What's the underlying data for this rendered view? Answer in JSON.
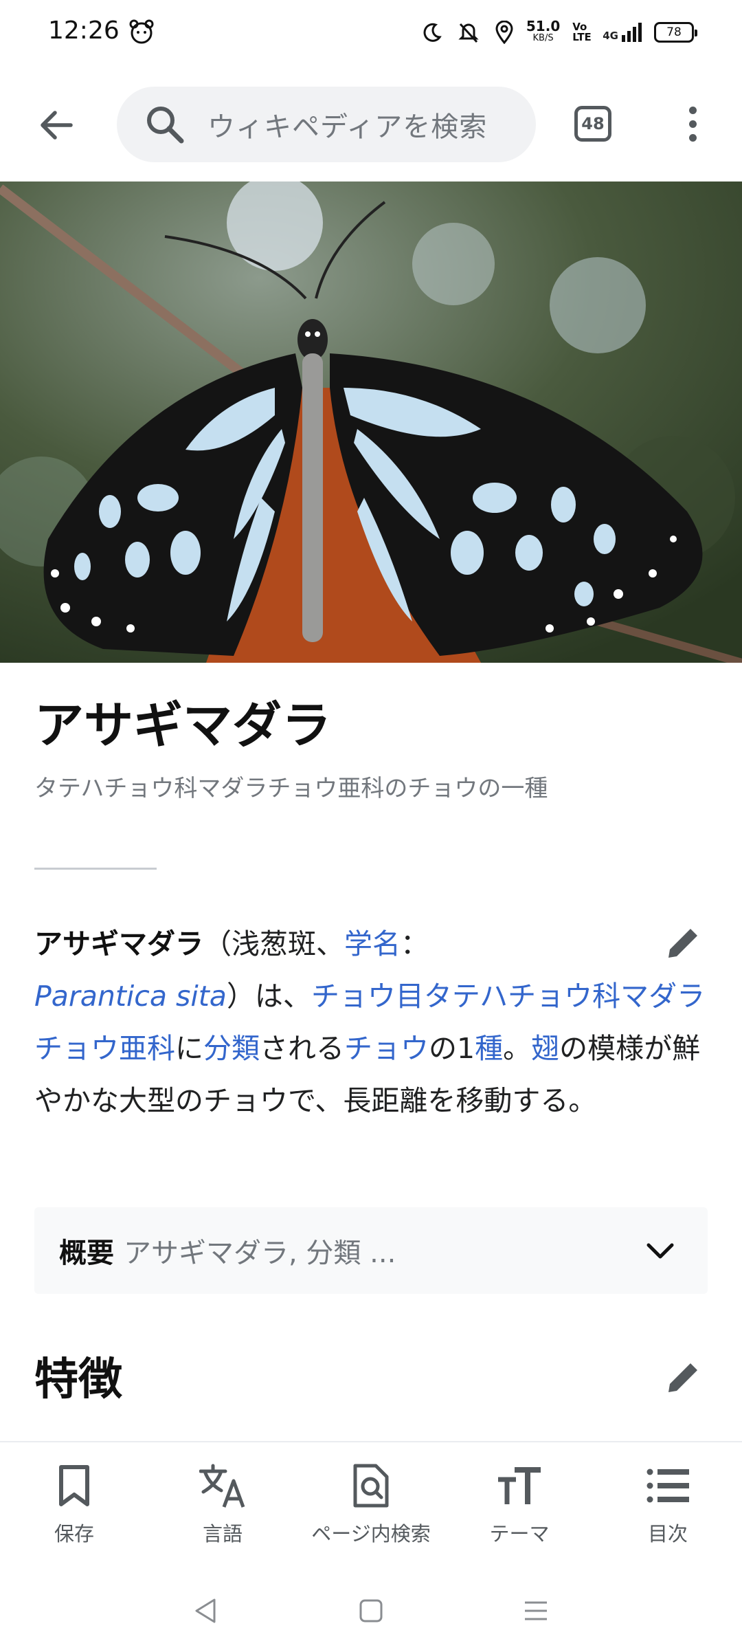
{
  "status_bar": {
    "time": "12:26",
    "net_speed": "51.0",
    "net_unit": "KB/S",
    "volte": "Vo LTE",
    "signal": "4G",
    "battery": "78"
  },
  "toolbar": {
    "search_placeholder": "ウィキペディアを検索",
    "tab_count": "48"
  },
  "article": {
    "title": "アサギマダラ",
    "description": "タテハチョウ科マダラチョウ亜科のチョウの一種",
    "lead": {
      "bold_term": "アサギマダラ",
      "t1": "（浅葱斑、",
      "link_scientific_name": "学名",
      "t2": "：",
      "binomial": "Parantica sita",
      "t3": "）は、",
      "link_order": "チョウ目タテハチョウ科マダラチョウ亜科",
      "t4": "に",
      "link_classification": "分類",
      "t5": "される",
      "link_butterfly": "チョウ",
      "t6": "の1",
      "link_species": "種",
      "t7": "。",
      "link_wing": "翅",
      "t8": "の模様が鮮やかな大型のチョウで、長距離を移動する。"
    },
    "infobox": {
      "label": "概要",
      "summary": "アサギマダラ, 分類 ..."
    },
    "section_heading": "特徴"
  },
  "bottom_bar": {
    "items": [
      {
        "label": "保存",
        "icon": "bookmark-icon"
      },
      {
        "label": "言語",
        "icon": "translate-icon"
      },
      {
        "label": "ページ内検索",
        "icon": "find-in-page-icon"
      },
      {
        "label": "テーマ",
        "icon": "text-size-icon"
      },
      {
        "label": "目次",
        "icon": "list-icon"
      }
    ]
  },
  "colors": {
    "link": "#3366cc",
    "muted_text": "#72777d",
    "icon_gray": "#54595d"
  }
}
